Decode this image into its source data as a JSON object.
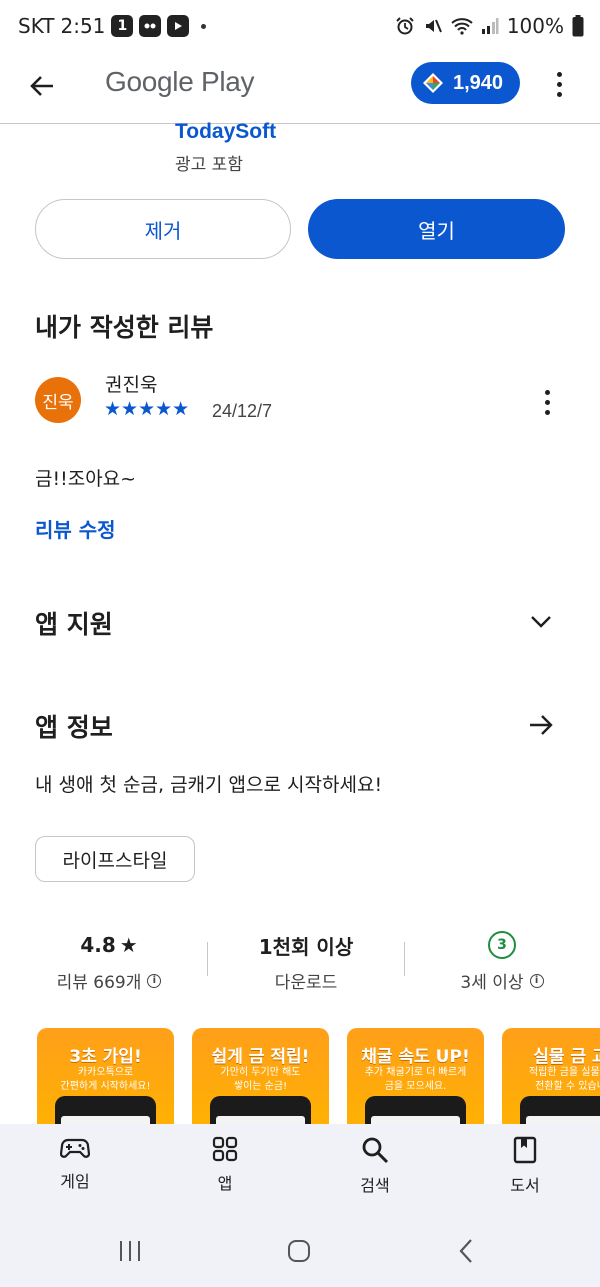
{
  "status_bar": {
    "carrier": "SKT",
    "time": "2:51",
    "notification_badge": "1",
    "battery": "100%"
  },
  "topbar": {
    "title": "Google Play",
    "points": "1,940"
  },
  "app": {
    "developer": "TodaySoft",
    "ad_label": "광고 포함",
    "remove_label": "제거",
    "open_label": "열기"
  },
  "review": {
    "section_title": "내가 작성한 리뷰",
    "avatar_text": "진욱",
    "reviewer": "권진욱",
    "stars": "★★★★★",
    "rating": 5,
    "date": "24/12/7",
    "text": "금!!조아요~",
    "edit_label": "리뷰 수정"
  },
  "app_support": {
    "title": "앱 지원"
  },
  "app_info": {
    "title": "앱 정보",
    "description": "내 생애 첫 순금, 금캐기 앱으로 시작하세요!",
    "category_chip": "라이프스타일"
  },
  "stats": {
    "rating_value": "4.8",
    "rating_star": "★",
    "reviews_label": "리뷰 669개",
    "downloads_value": "1천회 이상",
    "downloads_label": "다운로드",
    "age_badge": "3",
    "age_label": "3세 이상"
  },
  "screenshots": [
    {
      "title": "3초 가입!",
      "sub": "카카오톡으로\n간편하게 시작하세요!"
    },
    {
      "title": "쉽게 금 적립!",
      "sub": "가만히 두기만 해도\n쌓이는 순금!"
    },
    {
      "title": "채굴 속도 UP!",
      "sub": "추가 채굴기로 더 빠르게\n금을 모으세요."
    },
    {
      "title": "실물 금 교",
      "sub": "적립한 금을 실물 금\n전환할 수 있습니"
    }
  ],
  "bottom_nav": {
    "items": [
      {
        "label": "게임",
        "icon": "gamepad-icon"
      },
      {
        "label": "앱",
        "icon": "apps-grid-icon"
      },
      {
        "label": "검색",
        "icon": "search-icon"
      },
      {
        "label": "도서",
        "icon": "book-icon"
      }
    ]
  },
  "colors": {
    "accent": "#0b57d0",
    "avatar": "#e8710a",
    "age_badge": "#1e8e3e",
    "screenshot_bg": "#ffa61a"
  }
}
